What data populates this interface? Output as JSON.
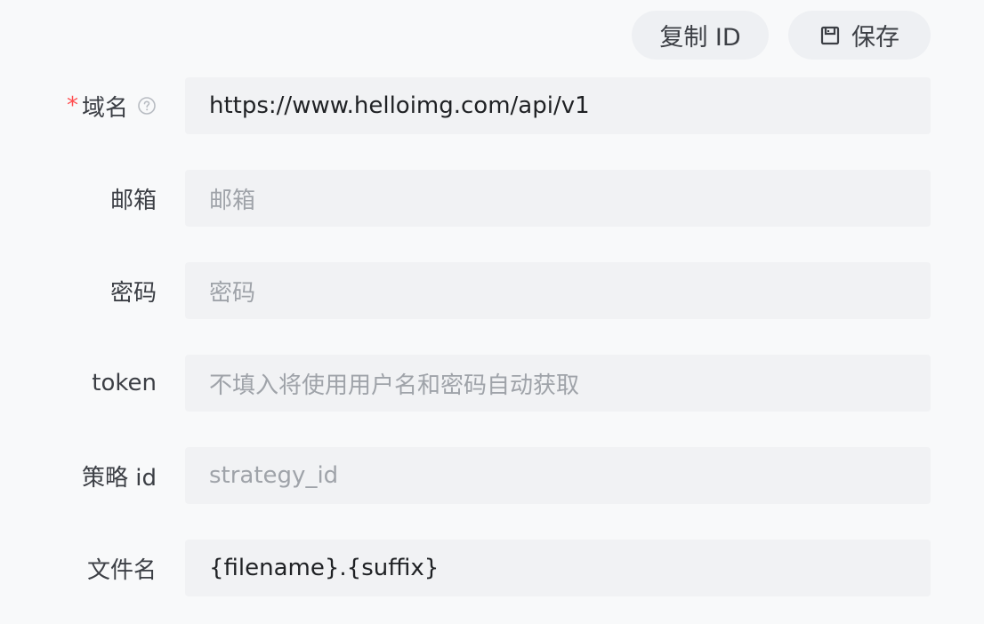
{
  "toolbar": {
    "copy_id_label": "复制 ID",
    "save_label": "保存"
  },
  "form": {
    "fields": [
      {
        "label": "域名",
        "required": true,
        "help_icon": "question-circle-icon",
        "value": "https://www.helloimg.com/api/v1",
        "placeholder": ""
      },
      {
        "label": "邮箱",
        "required": false,
        "value": "",
        "placeholder": "邮箱"
      },
      {
        "label": "密码",
        "required": false,
        "value": "",
        "placeholder": "密码"
      },
      {
        "label": "token",
        "required": false,
        "value": "",
        "placeholder": "不填入将使用用户名和密码自动获取"
      },
      {
        "label": "策略 id",
        "required": false,
        "value": "",
        "placeholder": "strategy_id"
      },
      {
        "label": "文件名",
        "required": false,
        "value": "{filename}.{suffix}",
        "placeholder": ""
      }
    ]
  },
  "colors": {
    "background": "#f8f9fa",
    "field_background": "#f1f2f4",
    "button_background": "#eef0f3",
    "required": "#ff4d4f",
    "placeholder": "#9fa3a9",
    "text": "#1f2124"
  }
}
